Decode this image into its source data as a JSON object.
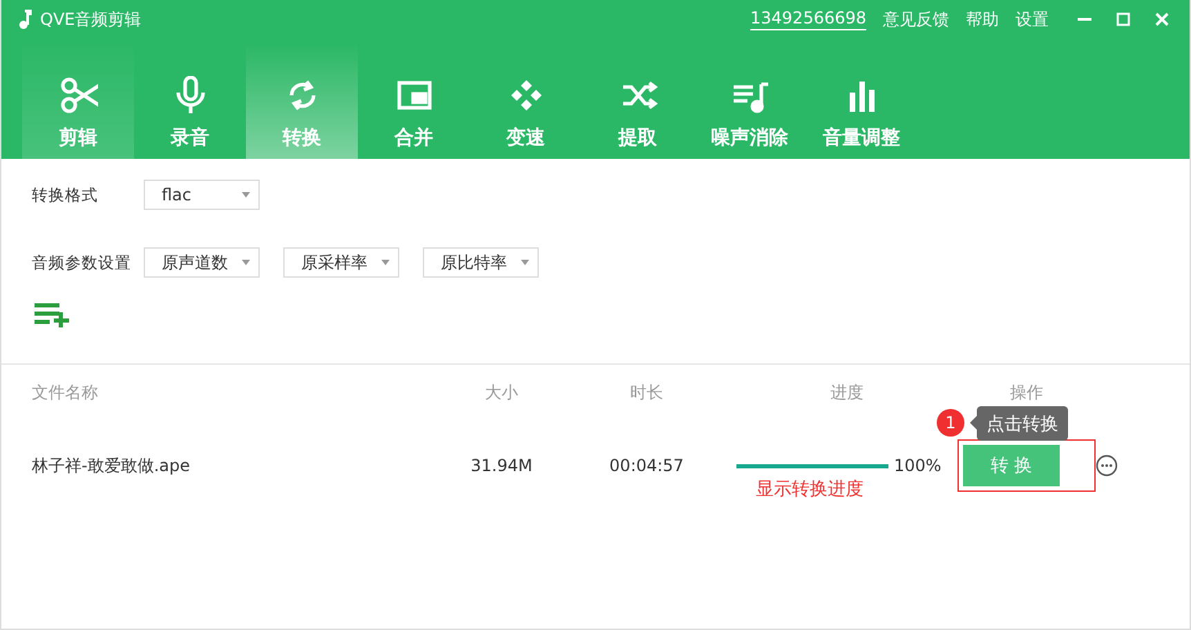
{
  "window": {
    "title": "QVE音频剪辑",
    "account": "13492566698",
    "menu": [
      "意见反馈",
      "帮助",
      "设置"
    ]
  },
  "tabs": [
    {
      "label": "剪辑",
      "selected": false,
      "hover": true
    },
    {
      "label": "录音",
      "selected": false,
      "hover": false
    },
    {
      "label": "转换",
      "selected": true,
      "hover": false
    },
    {
      "label": "合并",
      "selected": false,
      "hover": false
    },
    {
      "label": "变速",
      "selected": false,
      "hover": false
    },
    {
      "label": "提取",
      "selected": false,
      "hover": false
    },
    {
      "label": "噪声消除",
      "selected": false,
      "hover": false
    },
    {
      "label": "音量调整",
      "selected": false,
      "hover": false
    }
  ],
  "settings": {
    "format_label": "转换格式",
    "format": "flac",
    "params_label": "音频参数设置",
    "params": [
      "原声道数",
      "原采样率",
      "原比特率"
    ]
  },
  "table": {
    "columns": [
      "文件名称",
      "大小",
      "时长",
      "进度",
      "操作"
    ],
    "rows": [
      {
        "name": "林子祥-敢爱敢做.ape",
        "size": "31.94M",
        "duration": "00:04:57",
        "level": 1.0,
        "percent": "100%",
        "action": "转 换"
      }
    ]
  },
  "annotations": {
    "badge": "1",
    "tooltip": "点击转换",
    "progress_note": "显示转换进度"
  }
}
